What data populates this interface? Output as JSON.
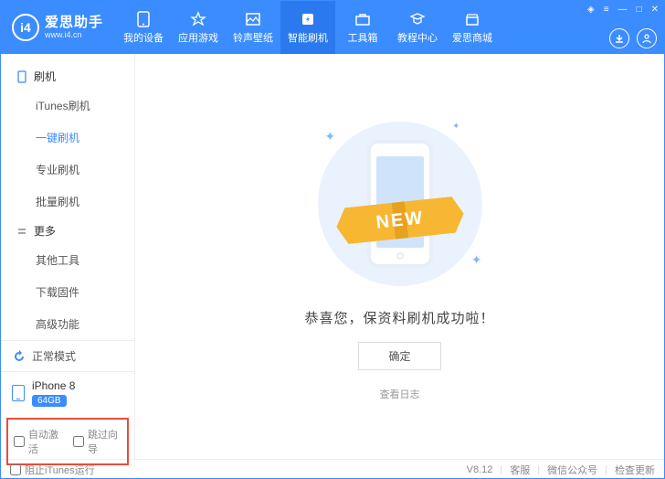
{
  "app": {
    "name": "爱思助手",
    "url": "www.i4.cn",
    "version": "V8.12"
  },
  "nav": [
    {
      "label": "我的设备"
    },
    {
      "label": "应用游戏"
    },
    {
      "label": "铃声壁纸"
    },
    {
      "label": "智能刷机",
      "active": true
    },
    {
      "label": "工具箱"
    },
    {
      "label": "教程中心"
    },
    {
      "label": "爱思商城"
    }
  ],
  "sidebar": {
    "group1": {
      "title": "刷机",
      "items": [
        "iTunes刷机",
        "一键刷机",
        "专业刷机",
        "批量刷机"
      ],
      "activeIndex": 1
    },
    "group2": {
      "title": "更多",
      "items": [
        "其他工具",
        "下载固件",
        "高级功能"
      ]
    },
    "status": "正常模式",
    "device": {
      "name": "iPhone 8",
      "storage": "64GB"
    },
    "options": {
      "autoActivate": "自动激活",
      "skipGuide": "跳过向导"
    }
  },
  "main": {
    "ribbon": "NEW",
    "success": "恭喜您，保资料刷机成功啦！",
    "confirm": "确定",
    "logLink": "查看日志"
  },
  "footer": {
    "blockItunes": "阻止iTunes运行",
    "links": [
      "客服",
      "微信公众号",
      "检查更新"
    ]
  }
}
